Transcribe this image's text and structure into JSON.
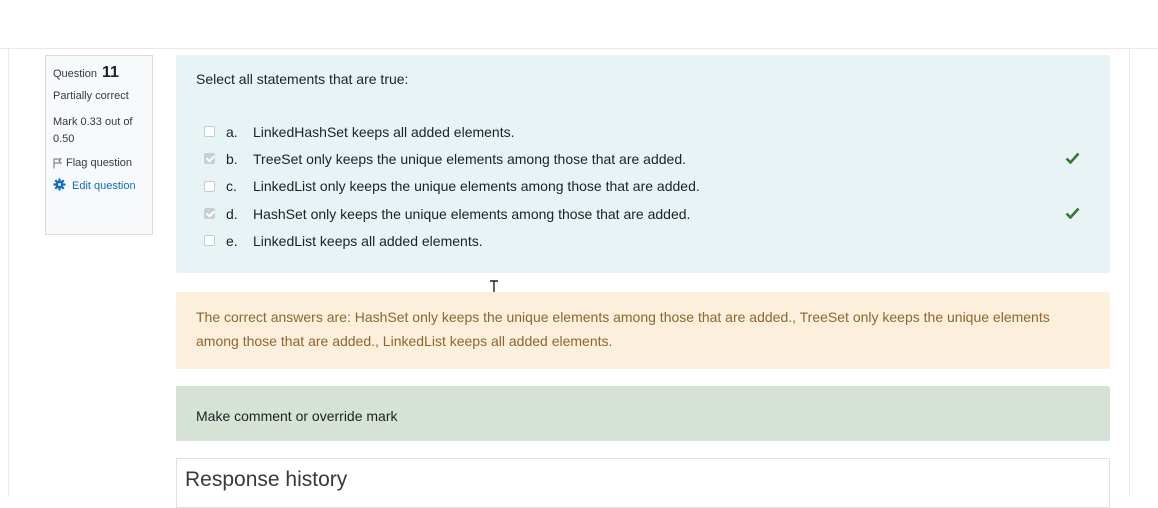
{
  "question_info": {
    "label": "Question",
    "number": "11",
    "state": "Partially correct",
    "grade": "Mark 0.33 out of 0.50",
    "flag_label": "Flag question",
    "edit_label": "Edit question"
  },
  "formulation": {
    "prompt": "Select all statements that are true:",
    "options": [
      {
        "letter": "a.",
        "text": "LinkedHashSet keeps all added elements.",
        "checked": false,
        "correct_mark": false
      },
      {
        "letter": "b.",
        "text": "TreeSet only keeps the unique elements among those that are added.",
        "checked": true,
        "correct_mark": true
      },
      {
        "letter": "c.",
        "text": "LinkedList only keeps the unique elements among those that are added.",
        "checked": false,
        "correct_mark": false
      },
      {
        "letter": "d.",
        "text": "HashSet only keeps the unique elements among those that are added.",
        "checked": true,
        "correct_mark": true
      },
      {
        "letter": "e.",
        "text": "LinkedList keeps all added elements.",
        "checked": false,
        "correct_mark": false
      }
    ]
  },
  "feedback": {
    "correct_answers": "The correct answers are: HashSet only keeps the unique elements among those that are added., TreeSet only keeps the unique elements among those that are added., LinkedList keeps all added elements."
  },
  "comment": {
    "label": "Make comment or override mark"
  },
  "history": {
    "title": "Response history"
  },
  "colors": {
    "formulation_bg": "#e7f3f5",
    "feedback_bg": "#fcefdc",
    "comment_bg": "#d7e2d6",
    "correct_green": "#357a32",
    "link_blue": "#0f6cbf"
  }
}
